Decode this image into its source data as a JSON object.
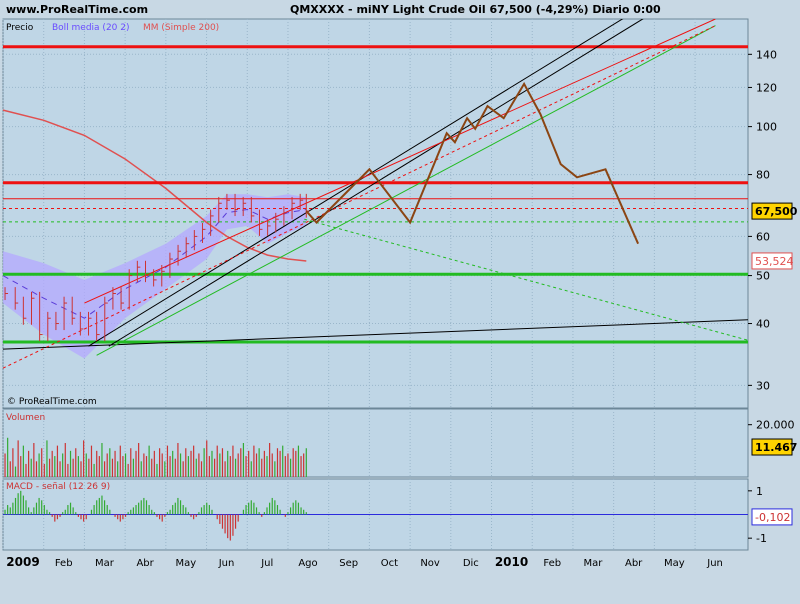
{
  "header": {
    "site": "www.ProRealTime.com",
    "symbol_line": "QMXXXX - miNY Light Crude Oil   67,500 (-4,29%)   Diario 0:00"
  },
  "chart_data": [
    {
      "type": "line",
      "panel": "price",
      "legend": [
        "Precio",
        "Boll media (20 2)",
        "MM (Simple 200)"
      ],
      "watermark": "© ProRealTime.com",
      "y_scale": "log",
      "ylim": [
        27,
        165
      ],
      "y_ticks": [
        30,
        40,
        50,
        60,
        80,
        100,
        120,
        140
      ],
      "x_ticks": [
        "2009",
        "Feb",
        "Mar",
        "Abr",
        "May",
        "Jun",
        "Jul",
        "Ago",
        "Sep",
        "Oct",
        "Nov",
        "Dic",
        "2010",
        "Feb",
        "Mar",
        "Abr",
        "May",
        "Jun"
      ],
      "x_range_months": [
        0,
        18.3
      ],
      "last_price": "67,500",
      "ma_value": "53,524",
      "colors": {
        "price": "#cc3333",
        "bollinger": "#b4a8ff",
        "ma200": "#e05050",
        "projection": "#8b4513",
        "support": "#22bb22",
        "resistance": "#ee1111",
        "grid": "#9ab6ca"
      },
      "price_series": [
        [
          0.05,
          46
        ],
        [
          0.3,
          44
        ],
        [
          0.5,
          41
        ],
        [
          0.7,
          45
        ],
        [
          0.9,
          38
        ],
        [
          1.1,
          41
        ],
        [
          1.3,
          40
        ],
        [
          1.5,
          44
        ],
        [
          1.7,
          41
        ],
        [
          1.9,
          39
        ],
        [
          2.1,
          41
        ],
        [
          2.3,
          38
        ],
        [
          2.5,
          44
        ],
        [
          2.7,
          46
        ],
        [
          2.9,
          44
        ],
        [
          3.1,
          50
        ],
        [
          3.3,
          52
        ],
        [
          3.5,
          50
        ],
        [
          3.7,
          49
        ],
        [
          3.9,
          51
        ],
        [
          4.1,
          54
        ],
        [
          4.3,
          56
        ],
        [
          4.5,
          58
        ],
        [
          4.7,
          60
        ],
        [
          4.9,
          62
        ],
        [
          5.1,
          66
        ],
        [
          5.3,
          70
        ],
        [
          5.5,
          71
        ],
        [
          5.7,
          68
        ],
        [
          5.9,
          70
        ],
        [
          6.1,
          66
        ],
        [
          6.3,
          62
        ],
        [
          6.5,
          63
        ],
        [
          6.7,
          65
        ],
        [
          6.9,
          67
        ],
        [
          7.1,
          70
        ],
        [
          7.3,
          71
        ],
        [
          7.45,
          67.5
        ]
      ],
      "bollinger_upper": [
        [
          0,
          56
        ],
        [
          1,
          53
        ],
        [
          2,
          49
        ],
        [
          3,
          53
        ],
        [
          4,
          58
        ],
        [
          5,
          66
        ],
        [
          5.5,
          73
        ],
        [
          6,
          73
        ],
        [
          6.5,
          72
        ],
        [
          7,
          73
        ],
        [
          7.45,
          72
        ]
      ],
      "bollinger_lower": [
        [
          0,
          44
        ],
        [
          1,
          38
        ],
        [
          2,
          34
        ],
        [
          3,
          41
        ],
        [
          4,
          47
        ],
        [
          5,
          54
        ],
        [
          5.5,
          62
        ],
        [
          6,
          63
        ],
        [
          6.5,
          58
        ],
        [
          7,
          61
        ],
        [
          7.45,
          63
        ]
      ],
      "bollinger_mid": [
        [
          0,
          50
        ],
        [
          1,
          45
        ],
        [
          2,
          41
        ],
        [
          3,
          47
        ],
        [
          4,
          52
        ],
        [
          5,
          60
        ],
        [
          5.5,
          67
        ],
        [
          6,
          68
        ],
        [
          6.5,
          65
        ],
        [
          7,
          67
        ],
        [
          7.45,
          68
        ]
      ],
      "ma200_series": [
        [
          0,
          108
        ],
        [
          1,
          103
        ],
        [
          2,
          96
        ],
        [
          3,
          86
        ],
        [
          4,
          75
        ],
        [
          5,
          64
        ],
        [
          5.5,
          60
        ],
        [
          6,
          57
        ],
        [
          6.5,
          55
        ],
        [
          7,
          54
        ],
        [
          7.45,
          53.5
        ]
      ],
      "projection_series": [
        [
          7.45,
          67.5
        ],
        [
          7.7,
          64
        ],
        [
          9.0,
          82
        ],
        [
          10.0,
          64
        ],
        [
          10.9,
          97
        ],
        [
          11.1,
          93
        ],
        [
          11.4,
          104
        ],
        [
          11.6,
          99
        ],
        [
          11.9,
          110
        ],
        [
          12.3,
          104
        ],
        [
          12.8,
          122
        ],
        [
          13.2,
          106
        ],
        [
          13.7,
          84
        ],
        [
          14.1,
          79
        ],
        [
          14.8,
          82
        ],
        [
          15.6,
          58
        ]
      ],
      "horizontal_lines": [
        {
          "y": 145,
          "color": "red",
          "style": "solid",
          "width": 3
        },
        {
          "y": 77,
          "color": "red",
          "style": "solid",
          "width": 3
        },
        {
          "y": 71.5,
          "color": "red",
          "style": "solid",
          "width": 1
        },
        {
          "y": 68.3,
          "color": "red",
          "style": "dashed",
          "width": 1
        },
        {
          "y": 64.2,
          "color": "green",
          "style": "dashed",
          "width": 1
        },
        {
          "y": 50.3,
          "color": "green",
          "style": "solid",
          "width": 3
        },
        {
          "y": 36.7,
          "color": "green",
          "style": "solid",
          "width": 3
        }
      ],
      "trend_lines": [
        {
          "from": [
            0.0,
            35.5
          ],
          "to": [
            18.3,
            40.7
          ],
          "color": "black",
          "style": "solid"
        },
        {
          "from": [
            2.1,
            36
          ],
          "to": [
            16.2,
            185
          ],
          "color": "black",
          "style": "solid"
        },
        {
          "from": [
            2.6,
            36
          ],
          "to": [
            16.7,
            185
          ],
          "color": "black",
          "style": "solid"
        },
        {
          "from": [
            2.3,
            34.5
          ],
          "to": [
            17.5,
            160
          ],
          "color": "green",
          "style": "solid"
        },
        {
          "from": [
            0.0,
            32.5
          ],
          "to": [
            17.5,
            160
          ],
          "color": "red",
          "style": "dashed"
        },
        {
          "from": [
            2.0,
            44
          ],
          "to": [
            17.5,
            165
          ],
          "color": "red",
          "style": "solid"
        },
        {
          "from": [
            7.4,
            65
          ],
          "to": [
            18.3,
            37
          ],
          "color": "green",
          "style": "dashed"
        }
      ]
    },
    {
      "type": "bar",
      "panel": "volume",
      "legend": "Volumen",
      "ylim": [
        0,
        26000
      ],
      "y_ticks": [
        20000
      ],
      "y_tick_labels": [
        "20.000"
      ],
      "last_value": "11.467",
      "values": [
        9000,
        15000,
        6000,
        11000,
        4000,
        14000,
        8000,
        12000,
        5000,
        10000,
        7000,
        13000,
        6000,
        9000,
        11000,
        5000,
        14000,
        7000,
        10000,
        8000,
        12000,
        6000,
        9000,
        13000,
        5000,
        10000,
        7000,
        11000,
        8000,
        6000,
        14000,
        9000,
        7000,
        12000,
        5000,
        10000,
        8000,
        13000,
        6000,
        9000,
        11000,
        7000,
        10000,
        6000,
        12000,
        8000,
        9000,
        5000,
        11000,
        7000,
        10000,
        13000,
        6000,
        9000,
        8000,
        12000,
        7000,
        10000,
        5000,
        11000,
        9000,
        6000,
        12000,
        8000,
        10000,
        7000,
        13000,
        9000,
        6000,
        11000,
        8000,
        10000,
        12000,
        7000,
        9000,
        6000,
        11000,
        14000,
        8000,
        10000,
        7000,
        12000,
        9000,
        11000,
        6000,
        10000,
        8000,
        12000,
        7000,
        9000,
        11000,
        13000,
        8000,
        10000,
        6000,
        12000,
        9000,
        11000,
        7000,
        10000,
        8000,
        13000,
        9000,
        6000,
        11000,
        10000,
        12000,
        8000,
        9000,
        7000,
        11000,
        10000,
        12000,
        8000,
        9000,
        11000
      ]
    },
    {
      "type": "bar",
      "panel": "macd",
      "legend": "MACD - señal (12 26 9)",
      "ylim": [
        -1.5,
        1.5
      ],
      "y_ticks": [
        1,
        -1
      ],
      "y_tick_labels": [
        "1",
        "-1"
      ],
      "last_value": "-0,102",
      "values": [
        0.2,
        0.4,
        0.3,
        0.5,
        0.7,
        0.9,
        1.0,
        0.8,
        0.6,
        0.3,
        0.1,
        0.3,
        0.5,
        0.7,
        0.6,
        0.4,
        0.2,
        0.1,
        -0.1,
        -0.3,
        -0.2,
        -0.1,
        0.1,
        0.2,
        0.4,
        0.5,
        0.3,
        0.1,
        -0.1,
        -0.2,
        -0.3,
        -0.2,
        0.0,
        0.2,
        0.4,
        0.6,
        0.7,
        0.8,
        0.6,
        0.4,
        0.2,
        0.0,
        -0.1,
        -0.2,
        -0.3,
        -0.2,
        -0.1,
        0.1,
        0.2,
        0.3,
        0.4,
        0.5,
        0.6,
        0.7,
        0.6,
        0.4,
        0.2,
        0.1,
        -0.1,
        -0.2,
        -0.3,
        -0.1,
        0.1,
        0.2,
        0.4,
        0.5,
        0.7,
        0.6,
        0.4,
        0.3,
        0.1,
        -0.1,
        -0.2,
        -0.1,
        0.1,
        0.3,
        0.4,
        0.5,
        0.4,
        0.2,
        0.0,
        -0.2,
        -0.4,
        -0.6,
        -0.8,
        -1.0,
        -1.1,
        -0.9,
        -0.6,
        -0.3,
        0.0,
        0.2,
        0.4,
        0.5,
        0.6,
        0.5,
        0.3,
        0.1,
        -0.1,
        0.1,
        0.3,
        0.5,
        0.7,
        0.6,
        0.4,
        0.2,
        0.0,
        -0.1,
        0.1,
        0.3,
        0.5,
        0.6,
        0.5,
        0.3,
        0.2,
        0.1
      ]
    }
  ]
}
